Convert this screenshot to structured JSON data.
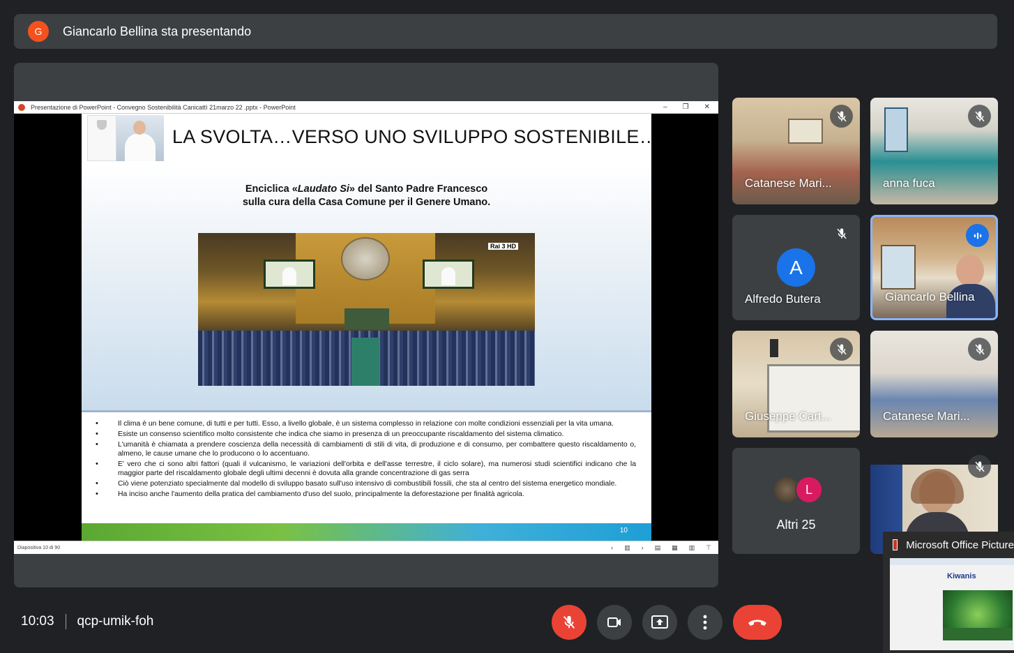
{
  "presenter": {
    "avatar_letter": "G",
    "avatar_color": "#f4511e",
    "text": "Giancarlo Bellina sta presentando"
  },
  "ppt": {
    "window_title": "Presentazione di PowerPoint  -  Convegno Sostenibilità  Canicattì 21marzo 22 .pptx - PowerPoint",
    "window_controls": [
      "–",
      "❐",
      "✕"
    ],
    "status_left": "Diapositiva 10 di 90",
    "status_icons": [
      "‹",
      "▥",
      "›",
      "▤",
      "▦",
      "▥",
      "⊤"
    ]
  },
  "slide": {
    "title": "LA SVOLTA…VERSO UNO SVILUPPO SOSTENIBILE…",
    "subtitle_prefix": "Enciclica «",
    "subtitle_italic": "Laudato Si",
    "subtitle_suffix": "» del Santo Padre Francesco",
    "subtitle_line2": "sulla cura della Casa Comune per il Genere Umano.",
    "photo_badge": "Rai 3 HD",
    "bullets": [
      "Il clima è un bene comune, di tutti e per tutti. Esso, a livello globale, è un sistema complesso in relazione con molte condizioni essenziali per la vita umana.",
      "Esiste un consenso scientifico molto consistente che indica che siamo in presenza di un preoccupante riscaldamento del sistema climatico.",
      "L'umanità è chiamata a prendere coscienza della necessità di cambiamenti di stili di vita, di produzione e di consumo, per combattere questo riscaldamento o, almeno, le cause umane che lo producono o lo accentuano.",
      "E' vero che ci sono altri fattori (quali il vulcanismo, le variazioni dell'orbita e dell'asse terrestre, il ciclo solare), ma numerosi studi scientifici indicano che la maggior parte del riscaldamento globale degli ultimi decenni è dovuta alla grande concentrazione di gas serra",
      "Ciò viene potenziato specialmente dal modello di sviluppo basato sull'uso intensivo di combustibili fossili, che sta al centro del sistema energetico mondiale.",
      "Ha inciso anche l'aumento della pratica del cambiamento d'uso del suolo, principalmente la deforestazione per finalità agricola."
    ],
    "page_number": "10"
  },
  "participants": [
    {
      "name": "Catanese Mari...",
      "muted": true
    },
    {
      "name": "anna fuca",
      "muted": true
    },
    {
      "name": "Alfredo Butera",
      "muted": true,
      "avatar_letter": "A",
      "avatar_color": "#1a73e8"
    },
    {
      "name": "Giancarlo Bellina",
      "speaking": true
    },
    {
      "name": "Giuseppe Cart...",
      "muted": true
    },
    {
      "name": "Catanese Mari...",
      "muted": true
    },
    {
      "name": "Altri 25",
      "mini_avatar_letter": "L",
      "mini_avatar_color": "#d81b60"
    },
    {
      "name": "",
      "muted": true
    }
  ],
  "meeting": {
    "time": "10:03",
    "code": "qcp-umik-foh"
  },
  "taskbar_preview": {
    "title": "Microsoft Office Picture",
    "thumb_brand": "Kiwanis"
  }
}
